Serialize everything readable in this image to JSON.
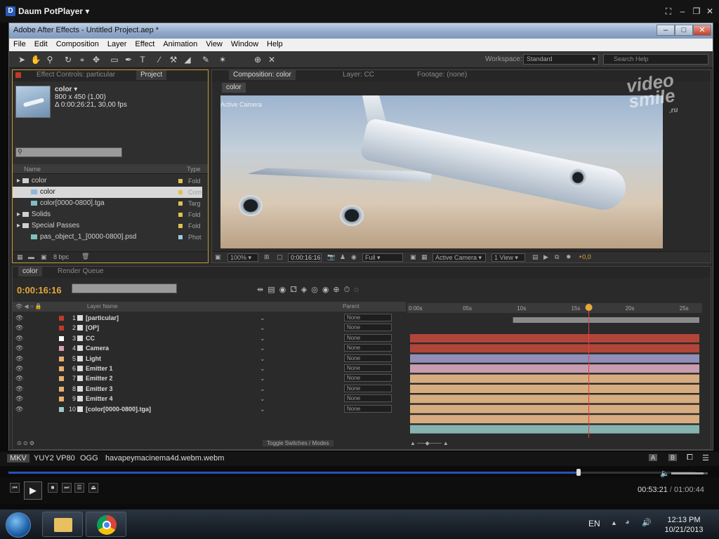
{
  "player": {
    "name": "Daum PotPlayer",
    "window_buttons": [
      "⛶",
      "–",
      "❐",
      "✕"
    ],
    "info": {
      "container": "MKV",
      "video_codec": "YUY2 VP80",
      "audio_codec": "OGG",
      "file_name": "havapeymacinema4d.webm.webm"
    },
    "seek_progress": 0.83,
    "volume_level": 0.88,
    "time_current": "00:53:21",
    "time_separator": "/",
    "time_total": "01:00:44",
    "ab_labels": [
      "A",
      "B"
    ]
  },
  "ae": {
    "window_title": "Adobe After Effects - Untitled Project.aep *",
    "menu": [
      "File",
      "Edit",
      "Composition",
      "Layer",
      "Effect",
      "Animation",
      "View",
      "Window",
      "Help"
    ],
    "workspace_label": "Workspace:",
    "workspace_value": "Standard",
    "search_help_placeholder": "Search Help",
    "watermark": [
      "video",
      "smile",
      ".ru"
    ]
  },
  "project_panel": {
    "tabs": [
      "Effect Controls: particular",
      "Project"
    ],
    "selected_item": "color ▾",
    "item_dims": "800 x 450 (1,00)",
    "item_duration": "Δ 0:00:26:21, 30,00 fps",
    "columns": [
      "Name",
      "Type"
    ],
    "items": [
      {
        "name": "color",
        "type": "Fold",
        "kind": "folder",
        "indent": 0,
        "color": "#e0c050"
      },
      {
        "name": "color",
        "type": "Com",
        "kind": "comp",
        "indent": 1,
        "color": "#e0c050",
        "selected": true
      },
      {
        "name": "color[0000-0800].tga",
        "type": "Targ",
        "kind": "file",
        "indent": 1,
        "color": "#e0c050"
      },
      {
        "name": "Solids",
        "type": "Fold",
        "kind": "folder",
        "indent": 0,
        "color": "#e0c050"
      },
      {
        "name": "Special Passes",
        "type": "Fold",
        "kind": "folder",
        "indent": 0,
        "color": "#e0c050"
      },
      {
        "name": "pas_object_1_[0000-0800].psd",
        "type": "Phot",
        "kind": "file",
        "indent": 1,
        "color": "#9ec8e0"
      }
    ],
    "bpc": "8 bpc"
  },
  "comp_panel": {
    "tabs": [
      "Composition: color",
      "Layer: CC",
      "Footage: (none)"
    ],
    "breadcrumb": "color",
    "view_label": "Active Camera",
    "zoom": "100%",
    "timecode": "0:00:16:16",
    "resolution": "Full",
    "camera": "Active Camera",
    "views": "1 View",
    "exposure": "+0,0"
  },
  "timeline": {
    "tabs": [
      "color",
      "Render Queue"
    ],
    "timecode": "0:00:16:16",
    "column_layer_name": "Layer Name",
    "column_parent": "Parent",
    "ruler_labels": [
      "0:00s",
      "05s",
      "10s",
      "15s",
      "20s",
      "25s"
    ],
    "playhead_seconds": 16.5,
    "duration_seconds": 26.7,
    "work_area": [
      9.5,
      26.7
    ],
    "toggle_label": "Toggle Switches / Modes",
    "layers": [
      {
        "num": "1",
        "name": "[particular]",
        "color": "#c0392b",
        "bar": "#b2453a",
        "parent": "None"
      },
      {
        "num": "2",
        "name": "[OP]",
        "color": "#c0392b",
        "bar": "#b2453a",
        "parent": "None"
      },
      {
        "num": "3",
        "name": "CC",
        "color": "#ffffff",
        "bar": "#8f8fb8",
        "parent": "None"
      },
      {
        "num": "4",
        "name": "Camera",
        "color": "#d8a0b8",
        "bar": "#c89db0",
        "parent": "None"
      },
      {
        "num": "5",
        "name": "Light",
        "color": "#e8b070",
        "bar": "#d7ac80",
        "parent": "None"
      },
      {
        "num": "6",
        "name": "Emitter 1",
        "color": "#e8b070",
        "bar": "#d7ac80",
        "parent": "None"
      },
      {
        "num": "7",
        "name": "Emitter 2",
        "color": "#e8b070",
        "bar": "#d7ac80",
        "parent": "None"
      },
      {
        "num": "8",
        "name": "Emitter 3",
        "color": "#e8b070",
        "bar": "#d7ac80",
        "parent": "None"
      },
      {
        "num": "9",
        "name": "Emitter 4",
        "color": "#e8b070",
        "bar": "#d7ac80",
        "parent": "None"
      },
      {
        "num": "10",
        "name": "[color[0000-0800].tga]",
        "color": "#9ec8c8",
        "bar": "#86b3b0",
        "parent": "None"
      }
    ]
  },
  "taskbar": {
    "language": "EN",
    "time": "12:13 PM",
    "date": "10/21/2013"
  }
}
